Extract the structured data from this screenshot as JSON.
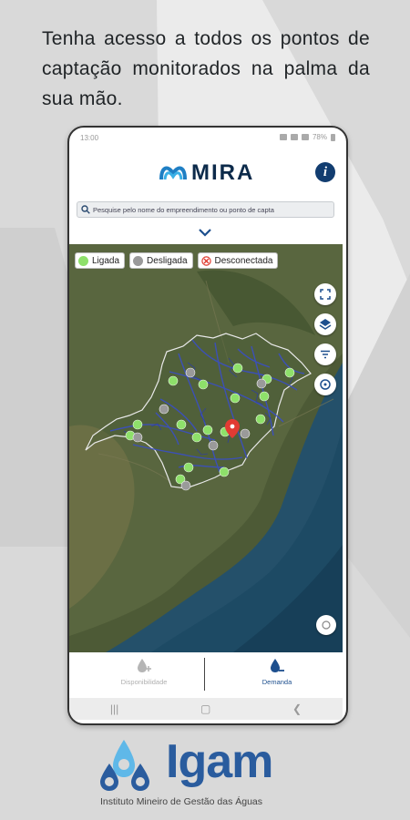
{
  "headline": "Tenha acesso a todos os pontos de captação monitorados na palma da sua mão.",
  "status_bar": {
    "time": "13:00",
    "battery": "78%"
  },
  "app": {
    "logo_text": "MIRA",
    "info_label": "i"
  },
  "search": {
    "placeholder": "Pesquise pelo nome do empreendimento ou ponto de capta"
  },
  "legend": {
    "ligada": {
      "label": "Ligada",
      "color": "#8ee06a"
    },
    "desligada": {
      "label": "Desligada",
      "color": "#9a9a9a"
    },
    "desconectada": {
      "label": "Desconectada",
      "color": "#e03a2f"
    }
  },
  "map_controls": [
    "fullscreen-icon",
    "layers-icon",
    "filter-icon",
    "refresh-icon",
    "location-icon"
  ],
  "bottom_nav": {
    "disponibilidade": {
      "label": "Disponibilidade",
      "active": false
    },
    "demanda": {
      "label": "Demanda",
      "active": true
    }
  },
  "footer": {
    "brand": "Igam",
    "subtitle": "Instituto Mineiro de Gestão das Águas"
  }
}
